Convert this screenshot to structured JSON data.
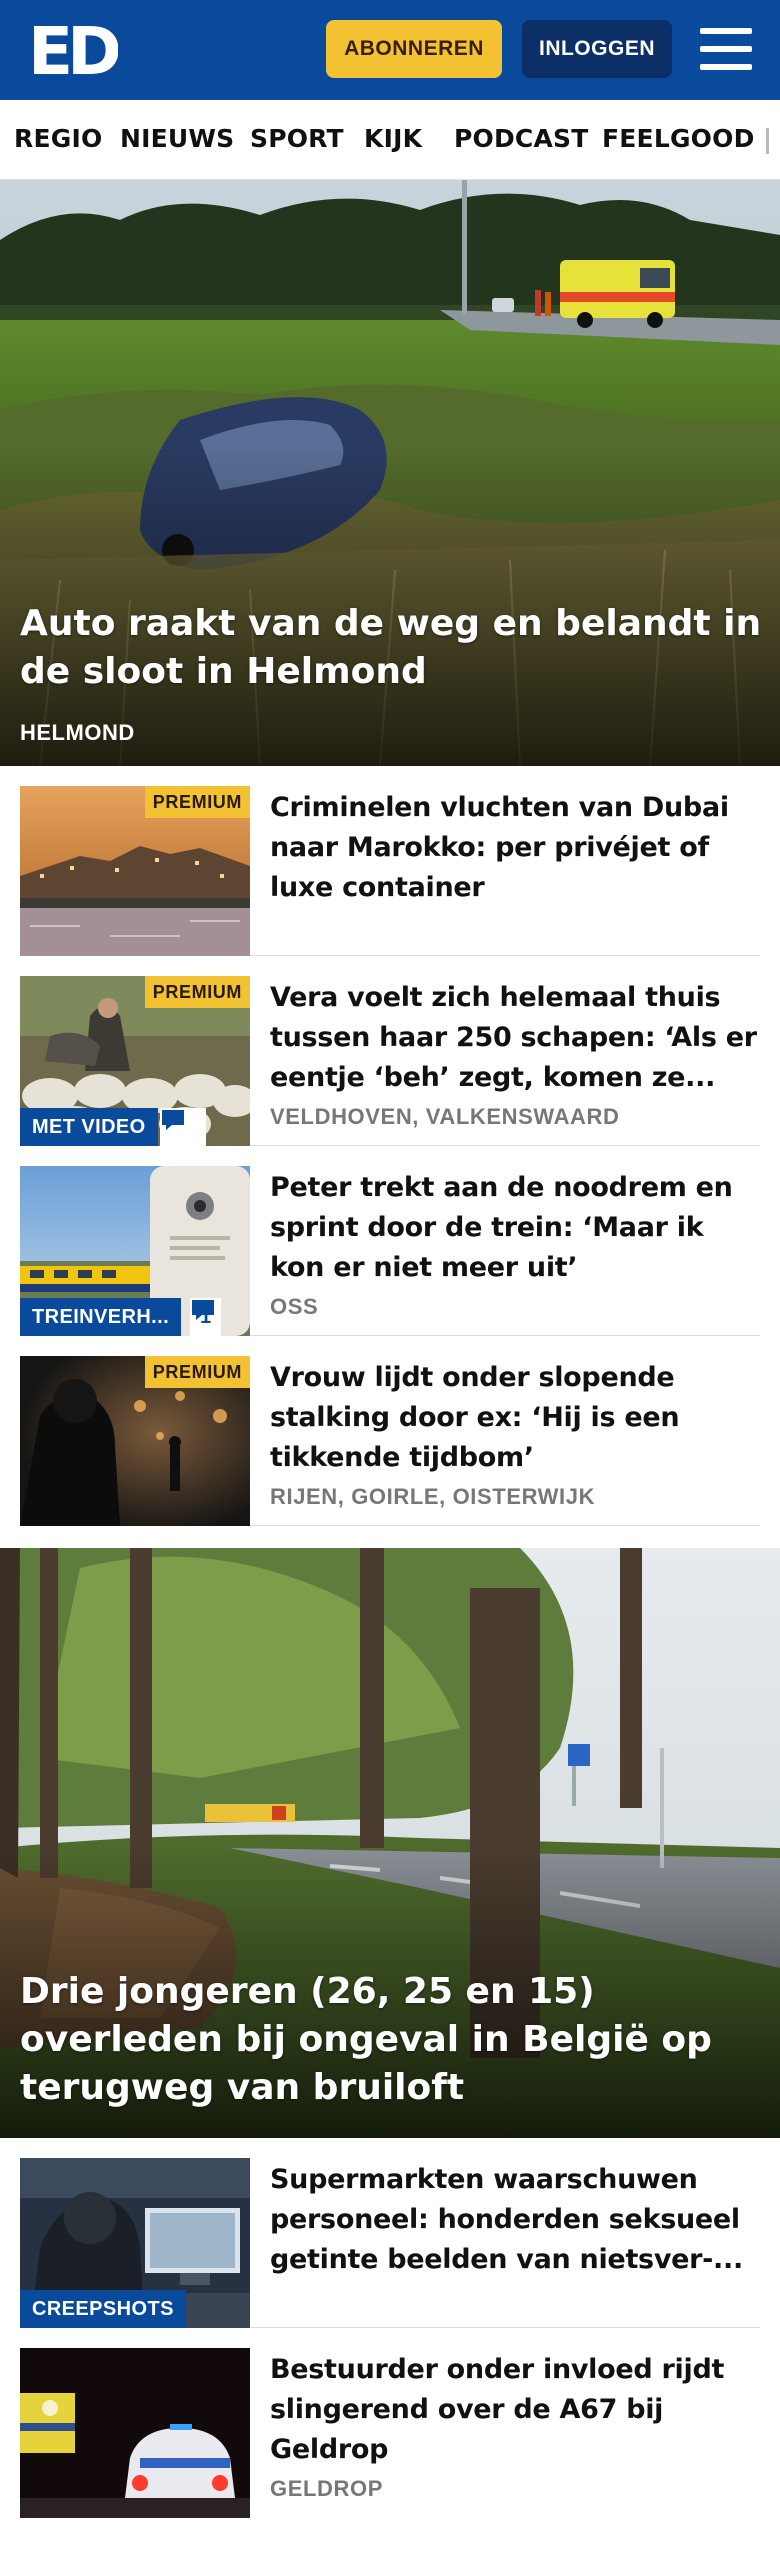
{
  "header": {
    "logo_text": "ED",
    "subscribe_label": "ABONNEREN",
    "login_label": "INLOGGEN",
    "brand_color": "#0a4a9c",
    "accent_color": "#f2c233"
  },
  "nav": {
    "items": [
      "REGIO",
      "NIEUWS",
      "SPORT",
      "KIJK",
      "PODCAST",
      "FEELGOOD"
    ]
  },
  "hero1": {
    "title": "Auto raakt van de weg en belandt in de sloot in Helmond",
    "location": "HELMOND"
  },
  "articles": [
    {
      "title": "Criminelen vluchten van Dubai naar Marokko: per privéjet of luxe container",
      "premium": "PREMIUM",
      "location": ""
    },
    {
      "title": "Vera voelt zich helemaal thuis tussen haar 250 schapen: ‘Als er eentje ‘beh’ zegt, komen ze...",
      "premium": "PREMIUM",
      "tag": "MET VIDEO",
      "location": "VELDHOVEN, VALKENSWAARD"
    },
    {
      "title": "Peter trekt aan de noodrem en sprint door de trein: ‘Maar ik kon er niet meer uit’",
      "tag": "TREINVERH...",
      "comments": "1",
      "location": "OSS"
    },
    {
      "title": "Vrouw lijdt onder slopende stalking door ex: ‘Hij is een tikkende tijdbom’",
      "premium": "PREMIUM",
      "location": "RIJEN, GOIRLE, OISTERWIJK"
    }
  ],
  "hero2": {
    "title": "Drie jongeren (26, 25 en 15) overleden bij ongeval in België op terugweg van bruiloft"
  },
  "articles2": [
    {
      "title": "Supermarkten waarschuwen personeel: honderden seksueel getinte beelden van nietsver-...",
      "tag": "CREEPSHOTS"
    },
    {
      "title": "Bestuurder onder invloed rijdt slingerend over de A67 bij Geldrop",
      "location": "GELDROP"
    }
  ],
  "icons": [
    "hamburger-menu-icon",
    "comment-icon"
  ]
}
